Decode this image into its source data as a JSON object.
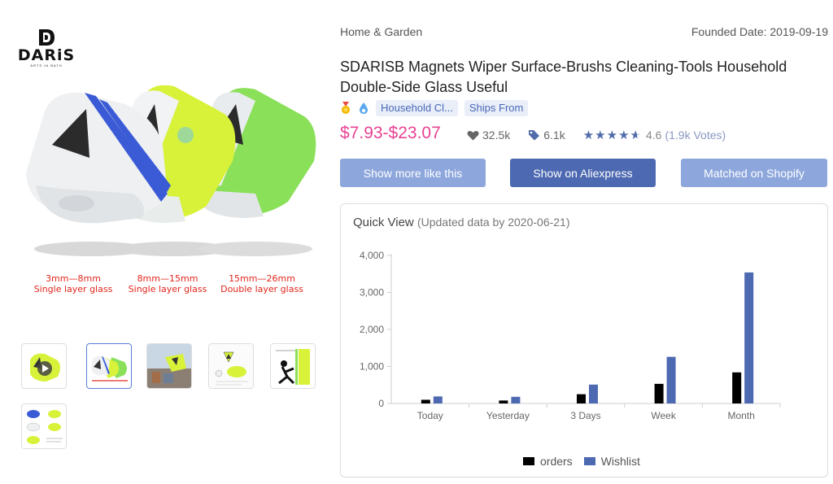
{
  "brand": {
    "name": "DARiS",
    "tagline": "ARTS IN BATH"
  },
  "hero": {
    "captions": [
      {
        "line1": "3mm—8mm",
        "line2": "Single layer glass"
      },
      {
        "line1": "8mm—15mm",
        "line2": "Single layer glass"
      },
      {
        "line1": "15mm—26mm",
        "line2": "Double layer glass"
      }
    ],
    "colors": {
      "white": "#eef0f2",
      "yellow": "#d8f23a",
      "green": "#8be05a",
      "blue": "#3b5bd6"
    }
  },
  "thumbnails": [
    {
      "name": "thumb-video",
      "active": false
    },
    {
      "name": "thumb-variants",
      "active": true
    },
    {
      "name": "thumb-in-use",
      "active": false
    },
    {
      "name": "thumb-diagram",
      "active": false
    },
    {
      "name": "thumb-cleaning",
      "active": false
    },
    {
      "name": "thumb-specs",
      "active": false
    }
  ],
  "product": {
    "category": "Home & Garden",
    "founded": "Founded Date: 2019-09-19",
    "title": "SDARISB Magnets Wiper Surface-Brushs Cleaning-Tools Household Double-Side Glass Useful",
    "tags": [
      "Household Cl...",
      "Ships From"
    ],
    "price": "$7.93-$23.07",
    "likes": "32.5k",
    "tags_count": "6.1k",
    "rating": "4.6",
    "votes": "(1.9k Votes)",
    "stars": 4.6
  },
  "buttons": {
    "more_like": "Show more like this",
    "aliexpress": "Show on Aliexpress",
    "shopify": "Matched on Shopify"
  },
  "quick_view": {
    "title": "Quick View",
    "updated": "(Updated data by 2020-06-21)"
  },
  "chart_data": {
    "type": "bar",
    "categories": [
      "Today",
      "Yesterday",
      "3 Days",
      "Week",
      "Month"
    ],
    "series": [
      {
        "name": "orders",
        "color": "#000000",
        "values": [
          100,
          80,
          250,
          530,
          840
        ]
      },
      {
        "name": "Wishlist",
        "color": "#4d69b1",
        "values": [
          190,
          180,
          510,
          1260,
          3540
        ]
      }
    ],
    "ylim": [
      0,
      4000
    ],
    "yticks": [
      "0",
      "1,000",
      "2,000",
      "3,000",
      "4,000"
    ],
    "ytick_values": [
      0,
      1000,
      2000,
      3000,
      4000
    ],
    "grid": false,
    "legend": "bottom"
  }
}
